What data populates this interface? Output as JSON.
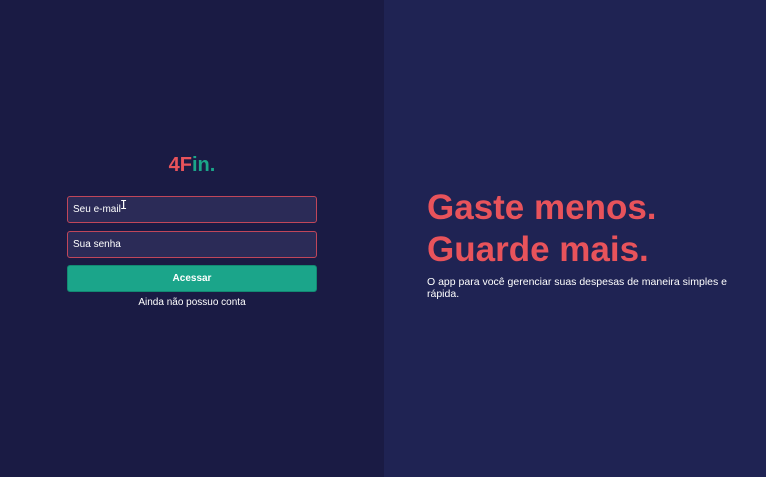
{
  "login": {
    "logo_part1": "4F",
    "logo_part2": "in.",
    "email_placeholder": "Seu e-mail",
    "password_placeholder": "Sua senha",
    "submit_label": "Acessar",
    "signup_link": "Ainda não possuo conta"
  },
  "hero": {
    "headline_line1": "Gaste menos.",
    "headline_line2": "Guarde mais.",
    "subtitle": "O app para você gerenciar suas despesas de maneira simples e rápida."
  },
  "colors": {
    "left_bg": "#1a1b44",
    "right_bg": "#1f2353",
    "accent_red": "#e8535b",
    "accent_green": "#1ba58a"
  }
}
